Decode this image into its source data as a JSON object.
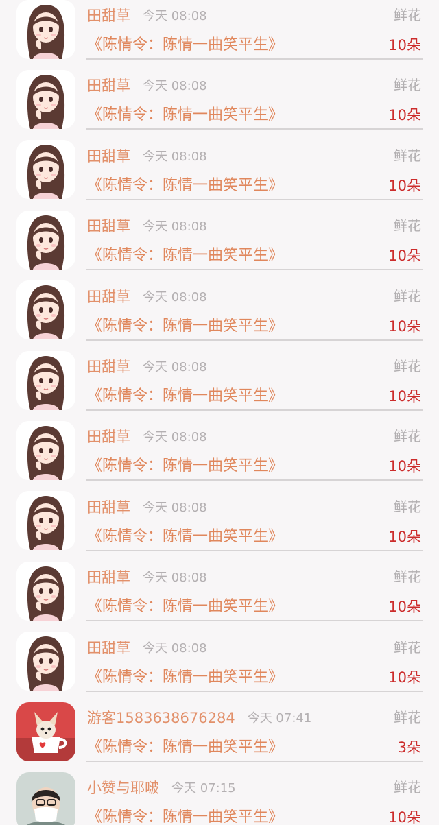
{
  "rows": [
    {
      "avatar": "girl-avatar-icon",
      "user": "田甜草",
      "time": "今天 08:08",
      "gift": "鲜花",
      "book": "《陈情令：陈情一曲笑平生》",
      "count": "10朵"
    },
    {
      "avatar": "girl-avatar-icon",
      "user": "田甜草",
      "time": "今天 08:08",
      "gift": "鲜花",
      "book": "《陈情令：陈情一曲笑平生》",
      "count": "10朵"
    },
    {
      "avatar": "girl-avatar-icon",
      "user": "田甜草",
      "time": "今天 08:08",
      "gift": "鲜花",
      "book": "《陈情令：陈情一曲笑平生》",
      "count": "10朵"
    },
    {
      "avatar": "girl-avatar-icon",
      "user": "田甜草",
      "time": "今天 08:08",
      "gift": "鲜花",
      "book": "《陈情令：陈情一曲笑平生》",
      "count": "10朵"
    },
    {
      "avatar": "girl-avatar-icon",
      "user": "田甜草",
      "time": "今天 08:08",
      "gift": "鲜花",
      "book": "《陈情令：陈情一曲笑平生》",
      "count": "10朵"
    },
    {
      "avatar": "girl-avatar-icon",
      "user": "田甜草",
      "time": "今天 08:08",
      "gift": "鲜花",
      "book": "《陈情令：陈情一曲笑平生》",
      "count": "10朵"
    },
    {
      "avatar": "girl-avatar-icon",
      "user": "田甜草",
      "time": "今天 08:08",
      "gift": "鲜花",
      "book": "《陈情令：陈情一曲笑平生》",
      "count": "10朵"
    },
    {
      "avatar": "girl-avatar-icon",
      "user": "田甜草",
      "time": "今天 08:08",
      "gift": "鲜花",
      "book": "《陈情令：陈情一曲笑平生》",
      "count": "10朵"
    },
    {
      "avatar": "girl-avatar-icon",
      "user": "田甜草",
      "time": "今天 08:08",
      "gift": "鲜花",
      "book": "《陈情令：陈情一曲笑平生》",
      "count": "10朵"
    },
    {
      "avatar": "girl-avatar-icon",
      "user": "田甜草",
      "time": "今天 08:08",
      "gift": "鲜花",
      "book": "《陈情令：陈情一曲笑平生》",
      "count": "10朵"
    },
    {
      "avatar": "puppy-teacup-avatar-icon",
      "user": "游客1583638676284",
      "time": "今天 07:41",
      "gift": "鲜花",
      "book": "《陈情令：陈情一曲笑平生》",
      "count": "3朵"
    },
    {
      "avatar": "person-masked-avatar-icon",
      "user": "小赞与耶啵",
      "time": "今天 07:15",
      "gift": "鲜花",
      "book": "《陈情令：陈情一曲笑平生》",
      "count": "10朵"
    }
  ]
}
